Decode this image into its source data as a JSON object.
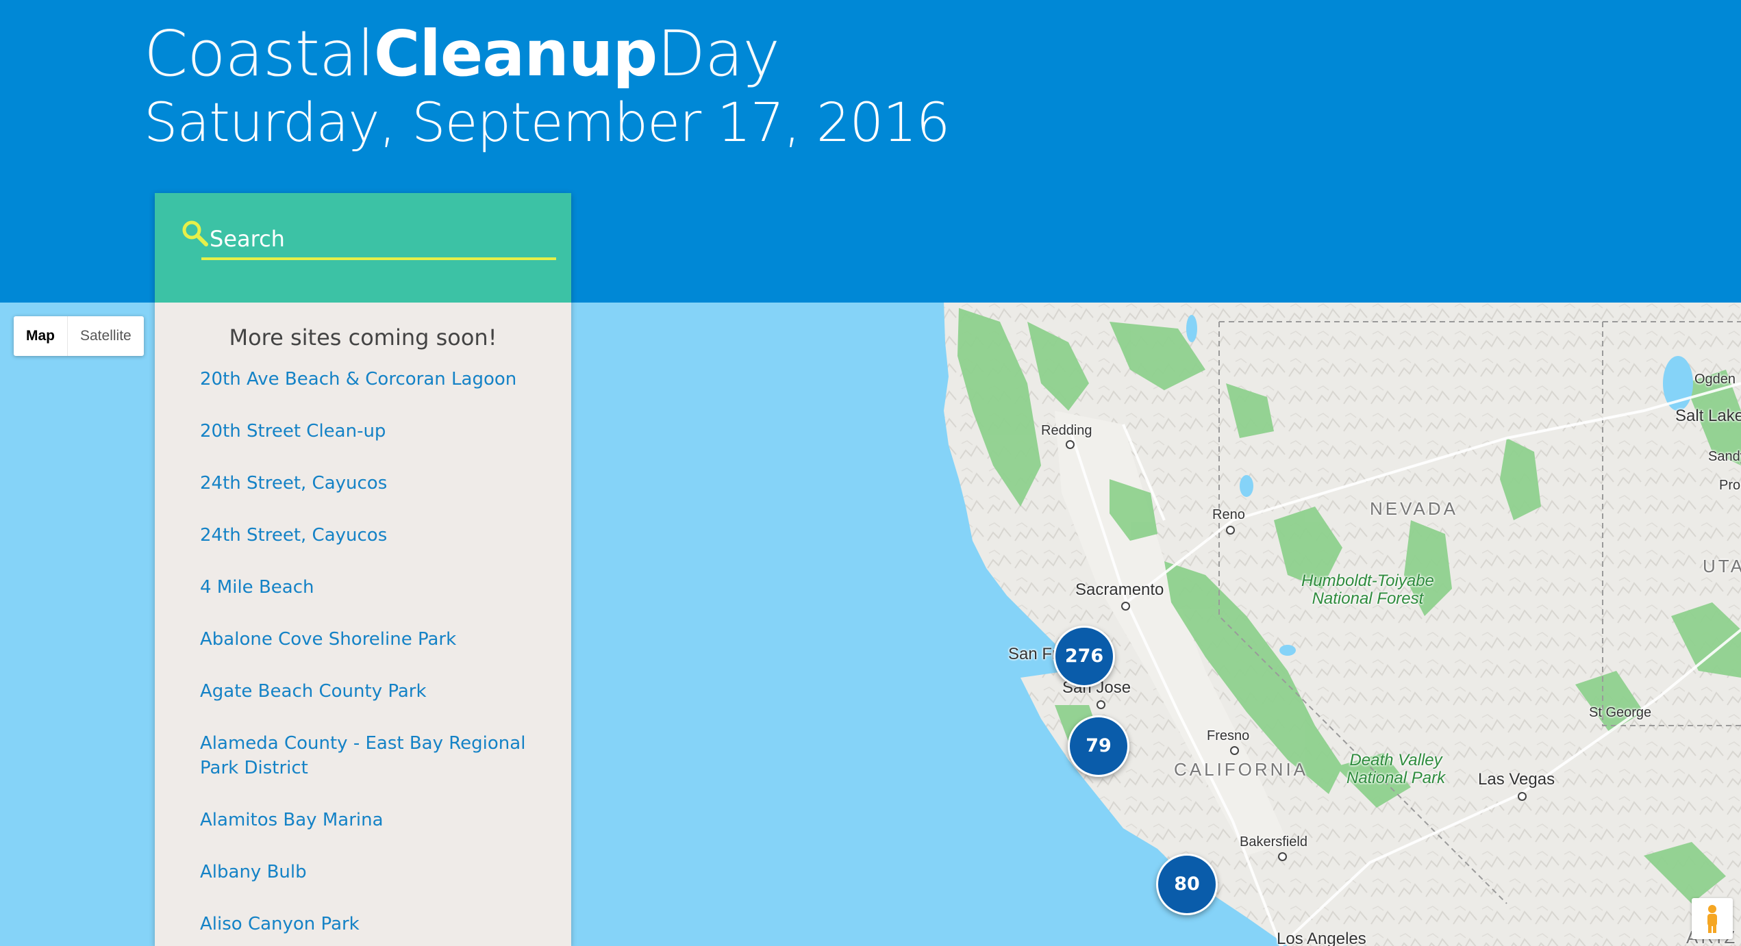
{
  "header": {
    "title_part1": "Coastal",
    "title_part2": "Cleanup",
    "title_part3": "Day",
    "date": "Saturday, September 17, 2016"
  },
  "search": {
    "placeholder": "Search",
    "icon": "search-icon",
    "accent_color": "#e6f04a"
  },
  "sidebar": {
    "notice": "More sites coming soon!",
    "sites": [
      "20th Ave Beach & Corcoran Lagoon",
      "20th Street Clean-up",
      "24th Street, Cayucos",
      "24th Street, Cayucos",
      "4 Mile Beach",
      "Abalone Cove Shoreline Park",
      "Agate Beach County Park",
      "Alameda County - East Bay Regional Park District",
      "Alamitos Bay Marina",
      "Albany Bulb",
      "Aliso Canyon Park"
    ]
  },
  "map": {
    "type_control": {
      "map_label": "Map",
      "satellite_label": "Satellite",
      "selected": "Map"
    },
    "clusters": [
      "276",
      "79",
      "80"
    ],
    "places": {
      "redding": "Redding",
      "reno": "Reno",
      "sacramento": "Sacramento",
      "san_francisco": "San Francisco",
      "san_jose": "San Jose",
      "fresno": "Fresno",
      "bakersfield": "Bakersfield",
      "las_vegas": "Las Vegas",
      "los_angeles": "Los Angeles",
      "st_george": "St George",
      "ogden": "Ogden",
      "salt_lake": "Salt Lake",
      "sandy": "Sandy",
      "provo": "Pro"
    },
    "states": {
      "nevada": "NEVADA",
      "california": "CALIFORNIA",
      "utah": "UTA",
      "arizona": "ARIZ"
    },
    "forests": {
      "humboldt_line1": "Humboldt-Toiyabe",
      "humboldt_line2": "National Forest",
      "death_valley_line1": "Death Valley",
      "death_valley_line2": "National Park"
    },
    "colors": {
      "ocean": "#85d3f8",
      "land": "#ecebe7",
      "forest": "#8fd18e",
      "cluster": "#0a5caa"
    }
  },
  "colors": {
    "header_bg": "#0088d6",
    "search_bg": "#3cc2a5",
    "list_bg": "#efebe8",
    "link": "#1482c6"
  }
}
